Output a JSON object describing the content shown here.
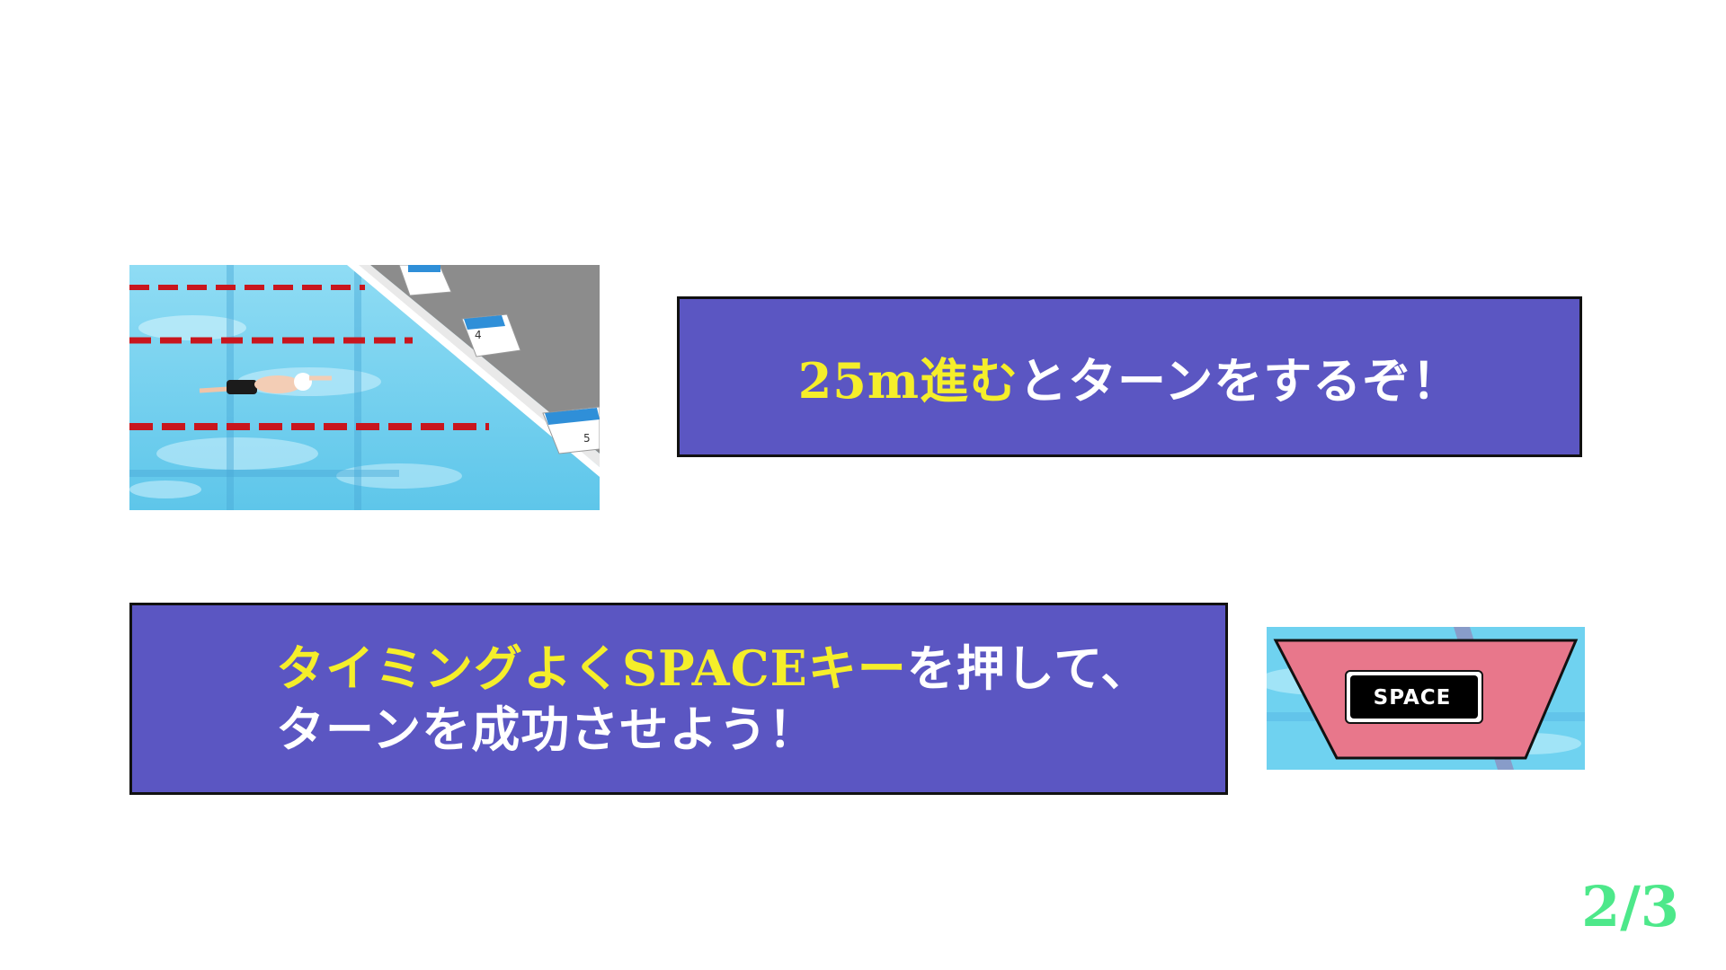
{
  "step1": {
    "text_highlight": "25m進む",
    "text_rest": "とターンをするぞ！"
  },
  "step2": {
    "line1_highlight": "タイミングよくSPACEキー",
    "line1_rest": "を押して、",
    "line2": "ターンを成功させよう！"
  },
  "space_key": {
    "label": "SPACE"
  },
  "pool_image": {
    "lane_numbers": [
      "4",
      "5"
    ]
  },
  "page_indicator": "2/3",
  "colors": {
    "panel_background": "#5b56c2",
    "highlight_text": "#f5ee2a",
    "page_indicator": "#4de88a",
    "space_button_frame": "#e8778b",
    "pool_water": "#6ccfee"
  }
}
